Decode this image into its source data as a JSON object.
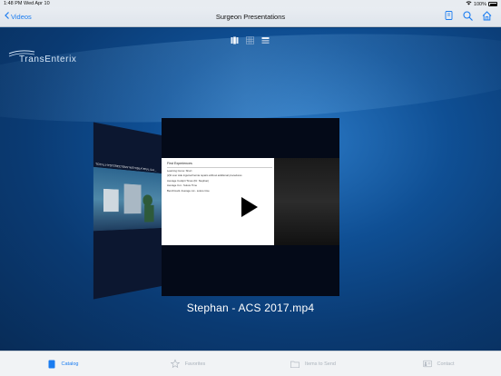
{
  "status_bar": {
    "time": "1:48 PM",
    "date": "Wed Apr 10",
    "battery": "100%"
  },
  "nav": {
    "back_label": "Videos",
    "title": "Surgeon Presentations",
    "icons": [
      "bookmark-icon",
      "search-icon",
      "home-icon"
    ]
  },
  "view_toggle": {
    "options": [
      "coverflow-view-icon",
      "grid-view-icon",
      "list-view-icon"
    ],
    "selected": "coverflow-view-icon"
  },
  "logo_text": "TransEnterix",
  "side_video": {
    "caption": "TOTAL HYSTERECTOMY WITH BILATERAL SAL..."
  },
  "current_video": {
    "title": "Stephan - ACS 2017.mp4",
    "slide": {
      "title": "First Experiences",
      "subtitle": "Learning Curve: Short",
      "lines": [
        "(2)6 over side inguinal hernia repairs without additional procedures",
        "Average Cockpit Times (Dr. Stephan)",
        "Average Cut - Suture Time",
        "Benchmark: Average cut - suture time"
      ]
    }
  },
  "tabs": [
    {
      "label": "Catalog",
      "icon": "catalog-icon",
      "active": true
    },
    {
      "label": "Favorites",
      "icon": "star-icon",
      "active": false
    },
    {
      "label": "Items to Send",
      "icon": "folder-icon",
      "active": false
    },
    {
      "label": "Contact",
      "icon": "contact-card-icon",
      "active": false
    }
  ],
  "colors": {
    "accent": "#1a7cf0",
    "background": "#0a3f78"
  }
}
